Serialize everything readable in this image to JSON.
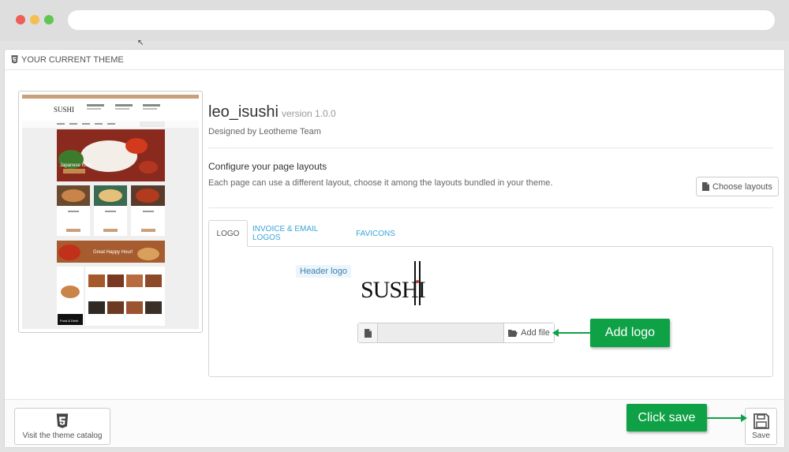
{
  "panel": {
    "heading": "YOUR CURRENT THEME"
  },
  "theme": {
    "name": "leo_isushi",
    "version": "version 1.0.0",
    "designed_by": "Designed by Leotheme Team"
  },
  "layouts": {
    "title": "Configure your page layouts",
    "description": "Each page can use a different layout, choose it among the layouts bundled in your theme.",
    "button": "Choose layouts"
  },
  "tabs": [
    {
      "label": "LOGO",
      "active": true
    },
    {
      "label": "INVOICE & EMAIL LOGOS",
      "active": false
    },
    {
      "label": "FAVICONS",
      "active": false
    }
  ],
  "logo_tab": {
    "header_logo_label": "Header logo",
    "logo_text": "SUSHI",
    "add_file": "Add file"
  },
  "annotations": {
    "add_logo": "Add logo",
    "click_save": "Click save"
  },
  "footer": {
    "catalog_button": "Visit the theme catalog",
    "save_button": "Save"
  },
  "preview": {
    "banner_text": "Japanese food",
    "happy_hour": "Great Happy Hour!",
    "food_drink": "Food & Drink"
  },
  "colors": {
    "accent_green": "#0fa146",
    "link_blue": "#3aa4d6",
    "html5_orange": "#e44d26"
  }
}
